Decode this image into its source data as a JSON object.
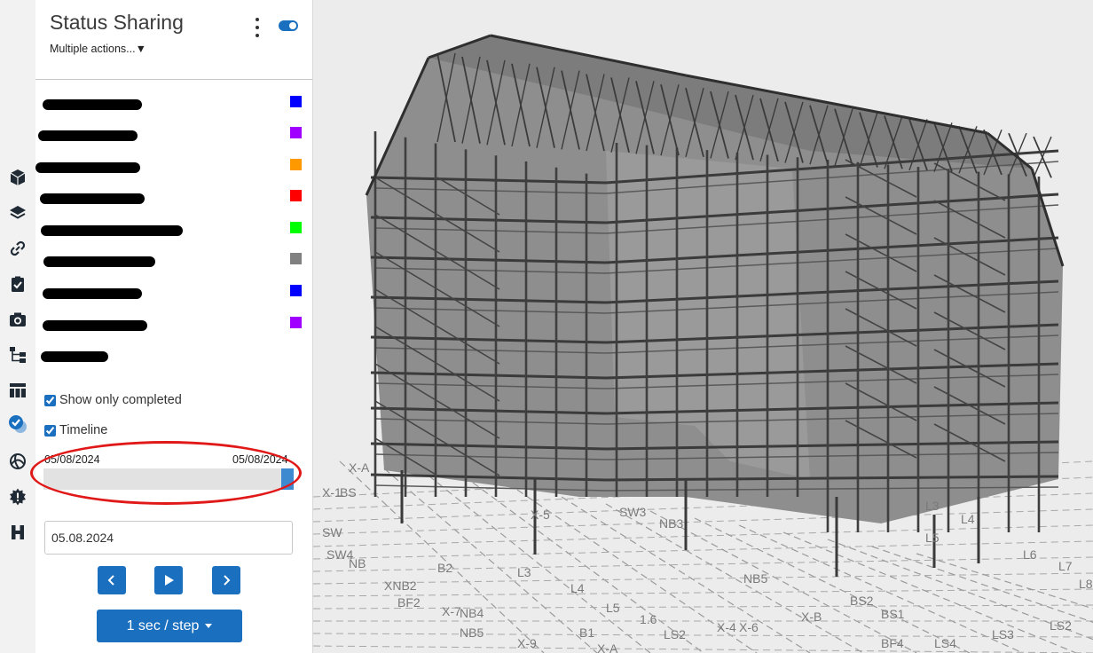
{
  "panel": {
    "title": "Status Sharing",
    "actions_label": "Multiple actions...▼"
  },
  "status_items": [
    {
      "color": "#0000ff"
    },
    {
      "color": "#a000ff"
    },
    {
      "color": "#ff9900"
    },
    {
      "color": "#ff0000"
    },
    {
      "color": "#00ff00"
    },
    {
      "color": "#808080"
    },
    {
      "color": "#0000ff"
    },
    {
      "color": "#a000ff"
    },
    {
      "color": null
    }
  ],
  "filters": {
    "show_only_completed_label": "Show only completed",
    "show_only_completed_checked": true,
    "timeline_label": "Timeline",
    "timeline_checked": true
  },
  "timeline": {
    "start_date": "05/08/2024",
    "end_date": "05/08/2024",
    "position_fraction": 1.0,
    "current_date": "05.08.2024"
  },
  "playback": {
    "speed_label": "1 sec / step"
  },
  "icons": {
    "rail": [
      "cube-icon",
      "layers-icon",
      "link-icon",
      "clipboard-check-icon",
      "camera-icon",
      "tree-structure-icon",
      "table-icon",
      "status-sharing-icon",
      "globe-icon",
      "settings-gear-icon",
      "h-logo-icon"
    ],
    "playback": [
      "chevron-left-icon",
      "play-icon",
      "chevron-right-icon"
    ]
  },
  "grid_labels": [
    "X-A",
    "X-1",
    "BS",
    "SW",
    "SW4",
    "NB",
    "XNB2",
    "BF2",
    "X-7",
    "NB4",
    "NB5",
    "X-9",
    "X-A",
    "B1",
    "B2",
    "L3",
    "L4",
    "L5",
    "L6",
    "L7",
    "L8",
    "L4",
    "L3",
    "BS2",
    "BS1",
    "BF4",
    "LS4",
    "LS3",
    "LS2",
    "NB5",
    "X-B",
    "X-6",
    "1.6",
    "LS2",
    "X-4",
    "X-5",
    "SW3",
    "NB3",
    "L5"
  ]
}
